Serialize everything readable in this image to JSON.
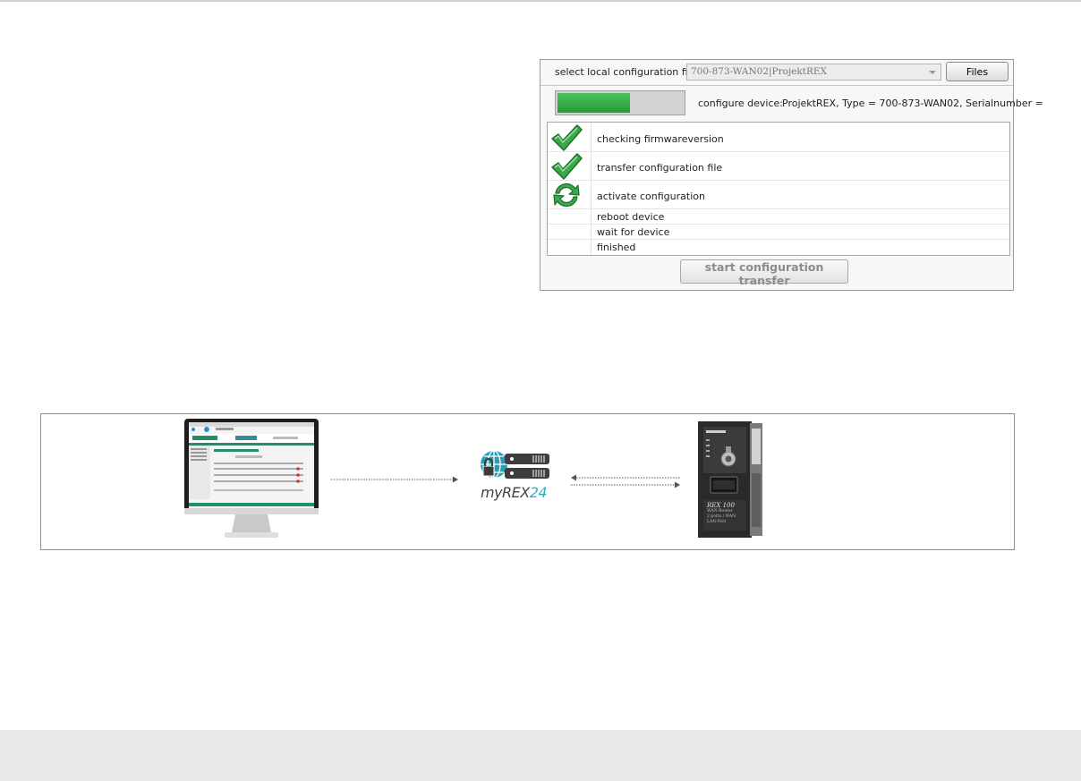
{
  "dialog": {
    "file_label": "select local configuration file",
    "selected_file": "700-873-WAN02|ProjektREX",
    "files_button": "Files",
    "progress_fraction": 0.58,
    "configure_label": "configure device:",
    "configure_value": "ProjektREX, Type = 700-873-WAN02, Serialnumber =",
    "steps": [
      {
        "label": "checking firmwareversion",
        "status": "done",
        "icon": "check-icon"
      },
      {
        "label": "transfer configuration file",
        "status": "done",
        "icon": "check-icon"
      },
      {
        "label": "activate configuration",
        "status": "in-progress",
        "icon": "refresh-icon"
      },
      {
        "label": "reboot device",
        "status": "pending"
      },
      {
        "label": "wait for device",
        "status": "pending"
      },
      {
        "label": "finished",
        "status": "pending"
      }
    ],
    "start_button": "start configuration transfer"
  },
  "diagram": {
    "brand_prefix": "myREX",
    "brand_suffix": "24",
    "monitor_app_name": "myREX24 v2",
    "device_name": "REX 100",
    "device_lines": [
      "WAN-Router",
      "2 ports / WAN",
      "LAN-Port"
    ]
  },
  "colors": {
    "progress": "#2eaa42",
    "check": "#3aa84a",
    "brand_accent": "#2bb0c9",
    "monitor_header": "#1e8f68"
  }
}
